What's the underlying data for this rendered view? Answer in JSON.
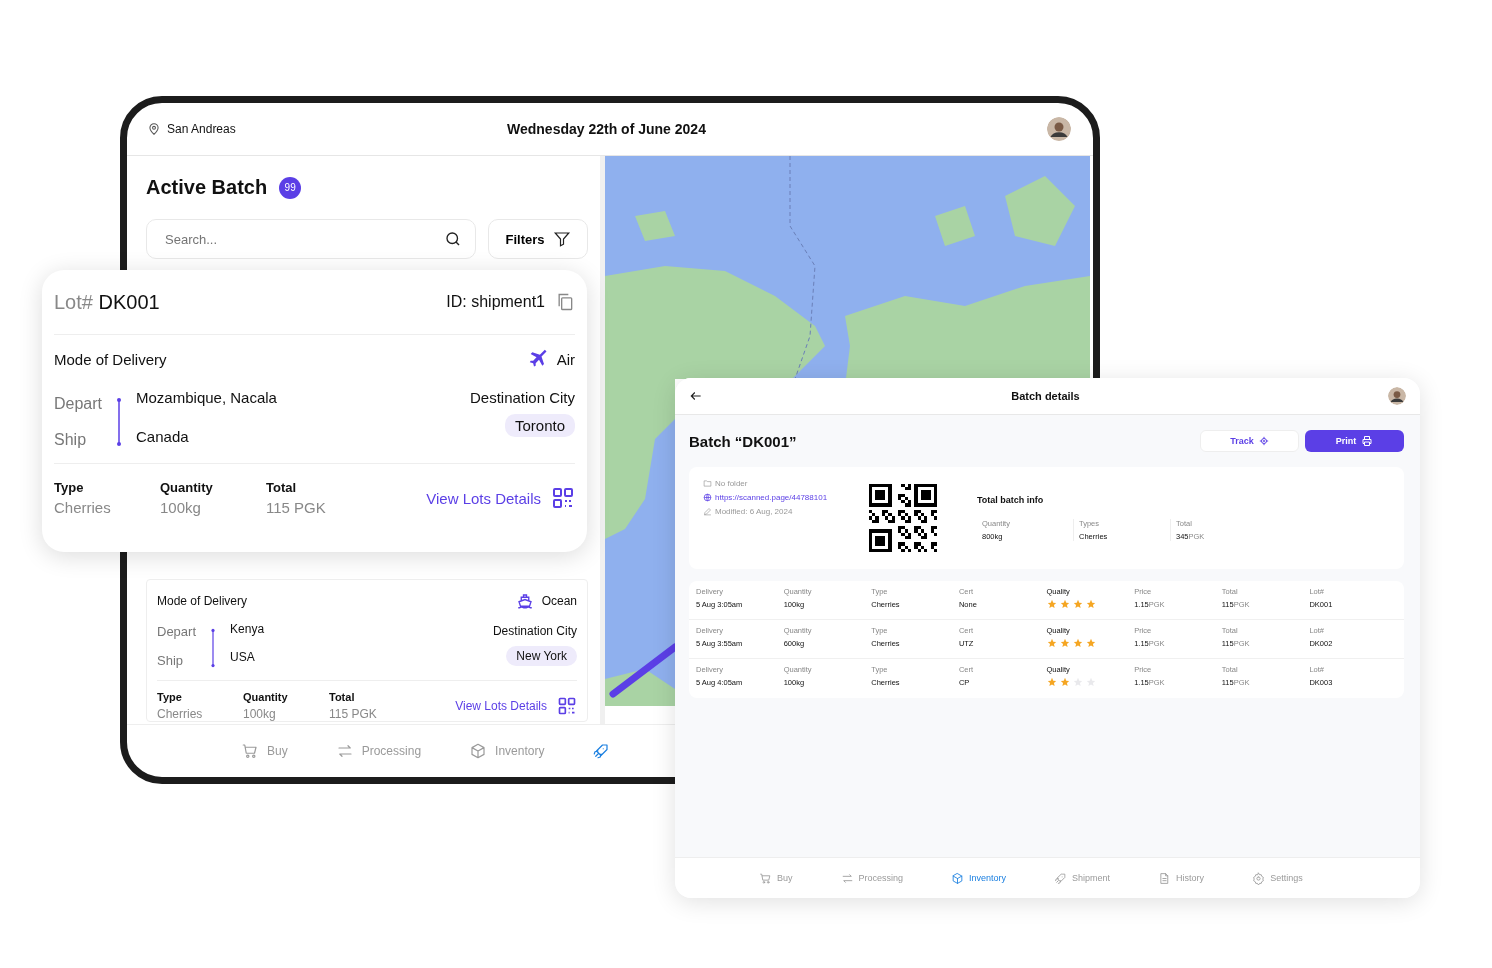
{
  "tablet": {
    "location": "San Andreas",
    "date": "Wednesday 22th of June 2024",
    "title": "Active Batch",
    "count": "99",
    "search": {
      "placeholder": "Search..."
    },
    "filters": "Filters",
    "shipment": {
      "delivery": {
        "label": "Mode of Delivery",
        "kind": "ocean",
        "value": "Ocean"
      },
      "depart_label": "Depart",
      "depart": "Kenya",
      "ship_label": "Ship",
      "ship": "USA",
      "dest_label": "Destination City",
      "dest": "New York",
      "type_label": "Type",
      "type": "Cherries",
      "quantity_label": "Quantity",
      "quantity": "100kg",
      "total_label": "Total",
      "total": "115 PGK",
      "link": "View Lots Details"
    },
    "nav": [
      {
        "label": "Buy",
        "selected": false
      },
      {
        "label": "Processing",
        "selected": false
      },
      {
        "label": "Inventory",
        "selected": false
      },
      {
        "selected": true
      }
    ]
  },
  "lot_card": {
    "lot_label": "Lot#",
    "lot": "DK001",
    "id": "ID: shipment1",
    "delivery": {
      "label": "Mode of Delivery",
      "kind": "air",
      "value": "Air"
    },
    "depart_label": "Depart",
    "depart": "Mozambique, Nacala",
    "ship_label": "Ship",
    "ship": "Canada",
    "dest_label": "Destination City",
    "dest": "Toronto",
    "type_label": "Type",
    "type": "Cherries",
    "quantity_label": "Quantity",
    "quantity": "100kg",
    "total_label": "Total",
    "total": "115 PGK",
    "link": "View Lots Details"
  },
  "batch_panel": {
    "title": "Batch details",
    "heading": "Batch “DK001”",
    "track": "Track",
    "print": "Print",
    "folder": "No folder",
    "url": "https://scanned.page/44788101",
    "modified": "Modified: 6 Aug, 2024",
    "info_title": "Total batch info",
    "info": [
      {
        "label": "Quantity",
        "value": "800kg"
      },
      {
        "label": "Types",
        "value": "Cherries"
      },
      {
        "label": "Total",
        "value": "345",
        "unit": "PGK"
      }
    ],
    "rows": [
      {
        "cells": [
          {
            "kind": "text",
            "label": "Delivery",
            "value": "5 Aug 3:05am"
          },
          {
            "kind": "text",
            "label": "Quantity",
            "value": "100kg"
          },
          {
            "kind": "text",
            "label": "Type",
            "value": "Cherries"
          },
          {
            "kind": "text",
            "label": "Cert",
            "value": "None"
          },
          {
            "kind": "stars",
            "label": "Quality",
            "stars": 4
          },
          {
            "kind": "text",
            "label": "Price",
            "value": "1.15",
            "unit": "PGK"
          },
          {
            "kind": "text",
            "label": "Total",
            "value": "115",
            "unit": "PGK"
          },
          {
            "kind": "text",
            "label": "Lot#",
            "value": "DK001"
          }
        ]
      },
      {
        "cells": [
          {
            "kind": "text",
            "label": "Delivery",
            "value": "5 Aug 3:55am"
          },
          {
            "kind": "text",
            "label": "Quantity",
            "value": "600kg"
          },
          {
            "kind": "text",
            "label": "Type",
            "value": "Cherries"
          },
          {
            "kind": "text",
            "label": "Cert",
            "value": "UTZ"
          },
          {
            "kind": "stars",
            "label": "Quality",
            "stars": 4
          },
          {
            "kind": "text",
            "label": "Price",
            "value": "1.15",
            "unit": "PGK"
          },
          {
            "kind": "text",
            "label": "Total",
            "value": "115",
            "unit": "PGK"
          },
          {
            "kind": "text",
            "label": "Lot#",
            "value": "DK002"
          }
        ]
      },
      {
        "cells": [
          {
            "kind": "text",
            "label": "Delivery",
            "value": "5 Aug 4:05am"
          },
          {
            "kind": "text",
            "label": "Quantity",
            "value": "100kg"
          },
          {
            "kind": "text",
            "label": "Type",
            "value": "Cherries"
          },
          {
            "kind": "text",
            "label": "Cert",
            "value": "CP"
          },
          {
            "kind": "stars",
            "label": "Quality",
            "stars": 2
          },
          {
            "kind": "text",
            "label": "Price",
            "value": "1.15",
            "unit": "PGK"
          },
          {
            "kind": "text",
            "label": "Total",
            "value": "115",
            "unit": "PGK"
          },
          {
            "kind": "text",
            "label": "Lot#",
            "value": "DK003"
          }
        ]
      }
    ],
    "nav": [
      {
        "label": "Buy",
        "selected": false
      },
      {
        "label": "Processing",
        "selected": false
      },
      {
        "label": "Inventory",
        "selected": true
      },
      {
        "label": "Shipment",
        "selected": false
      },
      {
        "label": "History",
        "selected": false
      },
      {
        "label": "Settings",
        "selected": false
      }
    ]
  }
}
